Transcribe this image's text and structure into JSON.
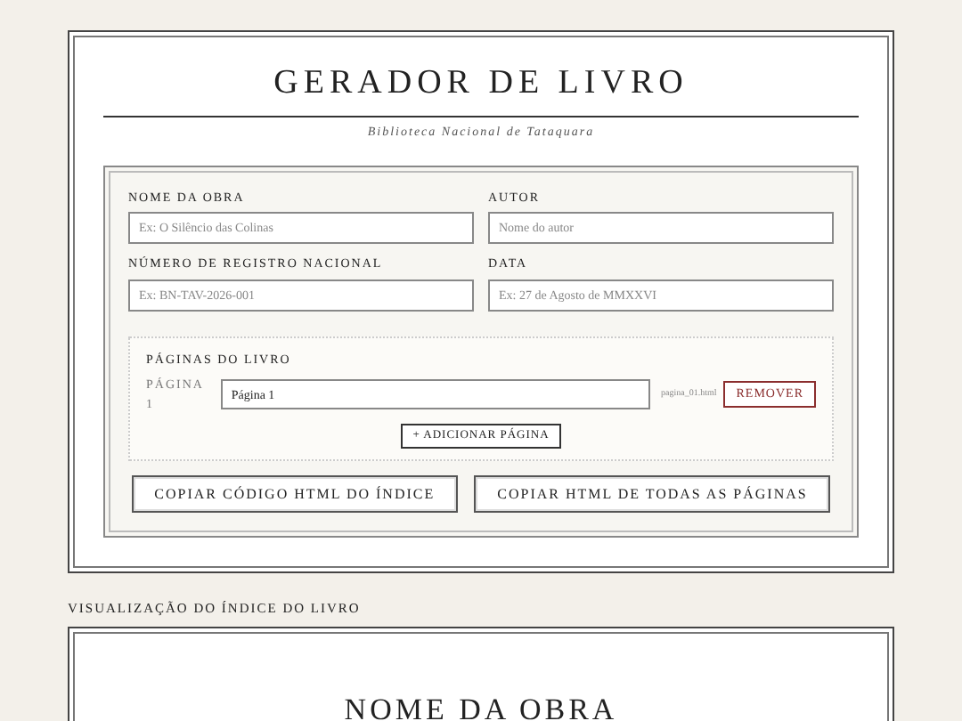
{
  "header": {
    "title": "GERADOR DE LIVRO",
    "subtitle": "Biblioteca Nacional de Tataquara"
  },
  "fields": [
    {
      "label": "NOME DA OBRA",
      "placeholder": "Ex: O Silêncio das Colinas"
    },
    {
      "label": "AUTOR",
      "placeholder": "Nome do autor"
    },
    {
      "label": "NÚMERO DE REGISTRO NACIONAL",
      "placeholder": "Ex: BN-TAV-2026-001"
    },
    {
      "label": "DATA",
      "placeholder": "Ex: 27 de Agosto de MMXXVI"
    }
  ],
  "pages_section": {
    "title": "PÁGINAS DO LIVRO",
    "pages": [
      {
        "label": "PÁGINA 1",
        "value": "Página 1",
        "filename": "pagina_01.html",
        "remove": "REMOVER"
      }
    ],
    "add_button": "+ ADICIONAR PÁGINA"
  },
  "actions": [
    "COPIAR CÓDIGO HTML DO ÍNDICE",
    "COPIAR HTML DE TODAS AS PÁGINAS"
  ],
  "preview": {
    "label": "VISUALIZAÇÃO DO ÍNDICE DO LIVRO",
    "title": "NOME DA OBRA"
  }
}
